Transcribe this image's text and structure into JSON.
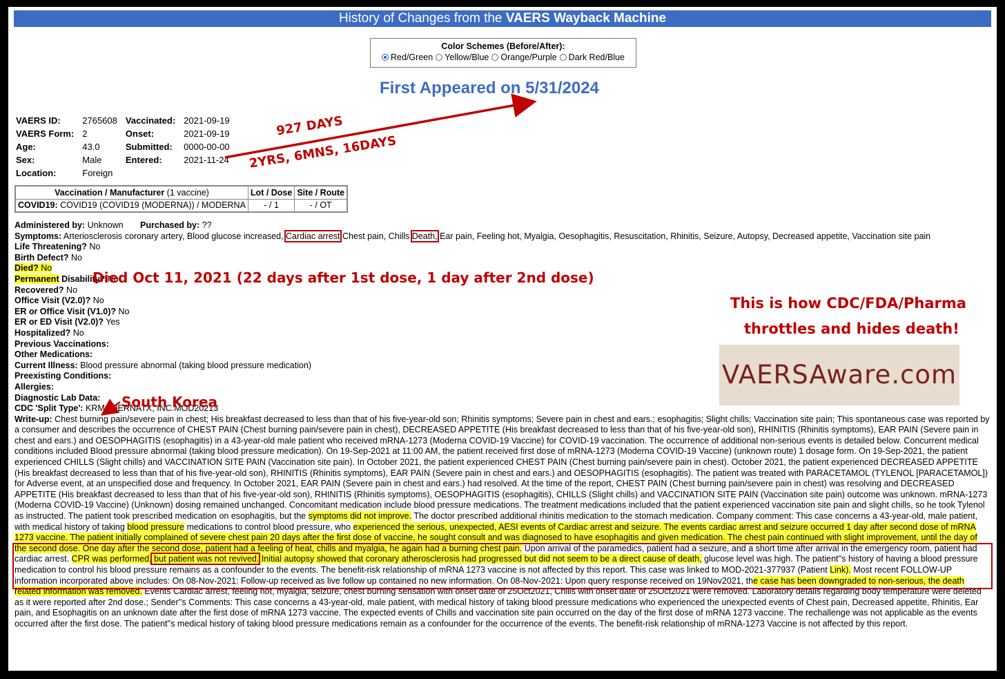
{
  "header": {
    "title_pre": "History of Changes from the ",
    "title_bold": "VAERS Wayback Machine"
  },
  "color_schemes": {
    "label": "Color Schemes (Before/After):",
    "options": [
      "Red/Green",
      "Yellow/Blue",
      "Orange/Purple",
      "Dark Red/Blue"
    ],
    "selected": "Red/Green"
  },
  "first_appeared": "First Appeared on 5/31/2024",
  "demographics": {
    "vaers_id_label": "VAERS ID:",
    "vaers_id": "2765608",
    "form_label": "VAERS Form:",
    "form": "2",
    "age_label": "Age:",
    "age": "43.0",
    "sex_label": "Sex:",
    "sex": "Male",
    "location_label": "Location:",
    "location": "Foreign",
    "vaccinated_label": "Vaccinated:",
    "vaccinated": "2021-09-19",
    "onset_label": "Onset:",
    "onset": "2021-09-19",
    "submitted_label": "Submitted:",
    "submitted": "0000-00-00",
    "entered_label": "Entered:",
    "entered": "2021-11-24"
  },
  "annotations": {
    "days": "927 DAYS",
    "span": "2YRS, 6MNS, 16DAYS",
    "died": "Died Oct 11, 2021 (22 days after 1st dose, 1 day after 2nd dose)",
    "cdc_line1": "This is how CDC/FDA/Pharma",
    "cdc_line2": "throttles and hides death!",
    "korea": "South Korea",
    "logo": "VAERSAware.com"
  },
  "vax_table": {
    "headers": {
      "vax": "Vaccination / Manufacturer",
      "vax_count": "(1 vaccine)",
      "lot": "Lot / Dose",
      "site": "Site / Route"
    },
    "row": {
      "type": "COVID19:",
      "name": "COVID19 (COVID19 (MODERNA)) / MODERNA",
      "lot": "- / 1",
      "site": "- / OT"
    }
  },
  "details": {
    "administered_label": "Administered by:",
    "administered": "Unknown",
    "purchased_label": "Purchased by:",
    "purchased": "??",
    "symptoms_label": "Symptoms:",
    "symptoms_pre": "Arteriosclerosis coronary artery, Blood glucose increased,",
    "symptom_cardiac": "Cardiac arrest",
    "symptoms_mid": "Chest pain, Chills",
    "symptom_death": "Death,",
    "symptoms_post": "Ear pain, Feeling hot, Myalgia, Oesophagitis, Resuscitation, Rhinitis, Seizure, Autopsy, Decreased appetite, Vaccination site pain",
    "life_label": "Life Threatening?",
    "life": "No",
    "birth_label": "Birth Defect?",
    "birth": "No",
    "died_label": "Died?",
    "died": "No",
    "perm_label": "Permanent",
    "perm_label2": " Disability?",
    "perm": "No",
    "recovered_label": "Recovered?",
    "recovered": "No",
    "office_label": "Office Visit (V2.0)?",
    "office": "No",
    "er1_label": "ER or Office Visit (V1.0)?",
    "er1": "No",
    "er2_label": "ER or ED Visit (V2.0)?",
    "er2": "Yes",
    "hosp_label": "Hospitalized?",
    "hosp": "No",
    "prev_vax_label": "Previous Vaccinations:",
    "other_meds_label": "Other Medications:",
    "illness_label": "Current Illness:",
    "illness": "Blood pressure abnormal (taking blood pressure medication)",
    "preexisting_label": "Preexisting Conditions:",
    "allergies_label": "Allergies:",
    "lab_label": "Diagnostic Lab Data:",
    "split_label": "CDC 'Split Type':",
    "split": "KRMODERNATX, INC.MOD20213",
    "writeup_label": "Write-up:",
    "w1": "Chest burning pain/severe pain in chest; His breakfast decreased to less than that of his five-year-old son; Rhinitis symptoms; Severe pain in chest and ears.; esophagitis; Slight chills; Vaccination site pain; This spontaneous case was reported by a consumer and describes the occurrence of CHEST PAIN (Chest burning pain/severe pain in chest), DECREASED APPETITE (His breakfast decreased to less than that of his five-year-old son), RHINITIS (Rhinitis symptoms), EAR PAIN (Severe pain in chest and ears.) and OESOPHAGITIS (esophagitis) in a 43-year-old male patient who received mRNA-1273 (Moderna COVID-19 Vaccine) for COVID-19 vaccination. The occurrence of additional non-serious events is detailed below. Concurrent medical conditions included Blood pressure abnormal (taking blood pressure medication). On 19-Sep-2021 at 11:00 AM, the patient received first dose of mRNA-1273 (Moderna COVID-19 Vaccine) (unknown route) 1 dosage form. On 19-Sep-2021, the patient experienced CHILLS (Slight chills) and VACCINATION SITE PAIN (Vaccination site pain). In October 2021, the patient experienced CHEST PAIN (Chest burning pain/severe pain in chest). October 2021, the patient experienced DECREASED APPETITE (His breakfast decreased to less than that of his five-year-old son), RHINITIS (Rhinitis symptoms), EAR PAIN (Severe pain in chest and ears.) and OESOPHAGITIS (esophagitis). The patient was treated with PARACETAMOL (TYLENOL [PARACETAMOL]) for Adverse event, at an unspecified dose and frequency. In October 2021, EAR PAIN (Severe pain in chest and ears.) had resolved. At the time of the report, CHEST PAIN (Chest burning pain/severe pain in chest) was resolving and DECREASED APPETITE (His breakfast decreased to less than that of his five-year-old son), RHINITIS (Rhinitis symptoms), OESOPHAGITIS (esophagitis), CHILLS (Slight chills) and VACCINATION SITE PAIN (Vaccination site pain) outcome was unknown. mRNA-1273 (Moderna COVID-19 Vaccine) (Unknown) dosing remained unchanged. Concomitant medication include blood pressure medications. The treatment medications included that the patient experienced vaccination site pain and slight chills, so he took Tylenol as instructed. The patient took prescribed medication on esophagitis, but the ",
    "w2_hl": "symptoms did not improve.",
    "w3": " The doctor prescribed additional rhinitis medication to the stomach medication. Company comment: This case concerns a 43-year-old, male patient, with medical history of taking ",
    "w4_hl": "blood pressure",
    "w5": " medications to control blood pressure, who ",
    "w6_hl": "experienced the serious, unexpected, AESI events of Cardiac arrest and seizure. The events cardiac arrest and seizure occurred 1 day after second dose of mRNA 1273 vaccine. The patient initially complained of severe chest pain 20 days after the first dose of vaccine, he sought consult and was diagnosed to have esophagitis and given medication. The chest pain continued with slight improvement, until the day of the second dose. One day after the second dose, patient had a feeling of heat, chills and myalgia, he again had a burning chest pain.",
    "w7": " Upon arrival of the paramedics, patient had a seizure, and a short time after arrival in the emergency room, patient had cardiac arrest. ",
    "w8_hl": "CPR was performed,",
    "w8b_hlbox": " but patient was not revived.",
    "w9_hl": " Initial autopsy showed that coronary atherosclerosis had progressed but did not seem to be a direct cause of death,",
    "w10": " glucose level was high. The patient''s history of having a blood pressure medication to control his blood pressure remains as a confounder to the events. The benefit-risk relationship of mRNA 1273 vaccine is not affected by this report. This case was linked to MOD-2021-377937 (Patient ",
    "w11_hl": "Link).",
    "w12": " Most recent FOLLOW-UP information incorporated above includes: On 08-Nov-2021: Follow-up received as live follow up contained no new information. On 08-Nov-2021: Upon query response received on 19Nov2021, th",
    "w13_hl": "e case has been downgraded to non-serious, the death related information was removed.",
    "w14": " Events Cardiac arrest, feeling hot, myalgia, seizure, chest burning sensation with onset date of 25Oct2021, Chills with onset date of 25Oct2021 were removed. Laboratory details regarding body temperature were deleted as it were reported after 2nd dose.; Sender''s Comments: This case concerns a 43-year-old, male patient, with medical history of taking blood pressure medications who experienced the unexpected events of Chest pain, Decreased appetite, Rhinitis, Ear pain, and Esophagitis on an unknown date after the first dose of mRNA 1273 vaccine. The expected events of Chills and vaccination site pain occurred on the day of the first dose of mRNA 1273 vaccine. The rechallenge was not applicable as the events occurred after the first dose. The patient''s medical history of taking blood pressure medications remain as a confounder for the occurrence of the events. The benefit-risk relationship of mRNA-1273 Vaccine is not affected by this report."
  },
  "colors": {
    "title_bar": "#3d6cc4",
    "annotation_red": "#c00000",
    "highlight": "#ffff33",
    "logo_bg": "#e6dccf",
    "logo_text": "#7b1f20"
  }
}
